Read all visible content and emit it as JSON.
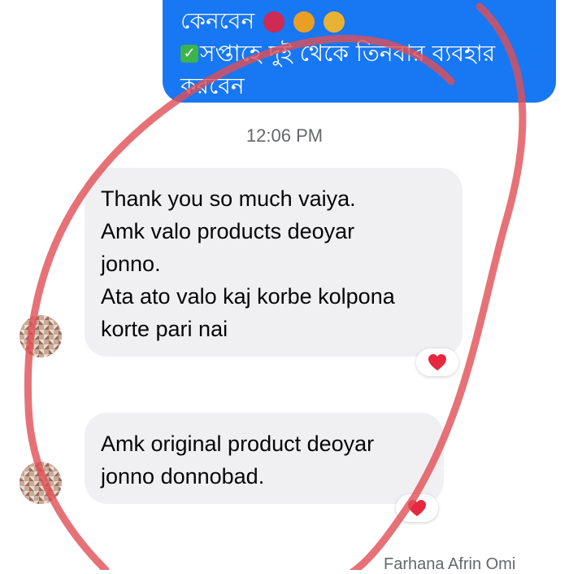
{
  "outgoing_message": {
    "partial_line": "কেনবেন",
    "line_1": "সপ্তাহে দুই থেকে তিনবার ব্যবহার",
    "line_2": "করবেন"
  },
  "timestamp": "12:06 PM",
  "incoming_messages": [
    {
      "lines": [
        "Thank you so much vaiya.",
        "Amk valo products deoyar",
        "jonno.",
        "Ata ato valo kaj korbe kolpona",
        "korte pari nai"
      ],
      "reaction": "heart-icon"
    },
    {
      "lines": [
        "Amk original product deoyar",
        "jonno donnobad."
      ],
      "reaction": "heart-icon"
    }
  ],
  "sender_name": "Farhana Afrin Omi",
  "colors": {
    "outgoing_bubble": "#1877f2",
    "incoming_bubble": "#f0f0f3",
    "reaction_heart": "#e4283f",
    "marker": "#e04f55"
  }
}
